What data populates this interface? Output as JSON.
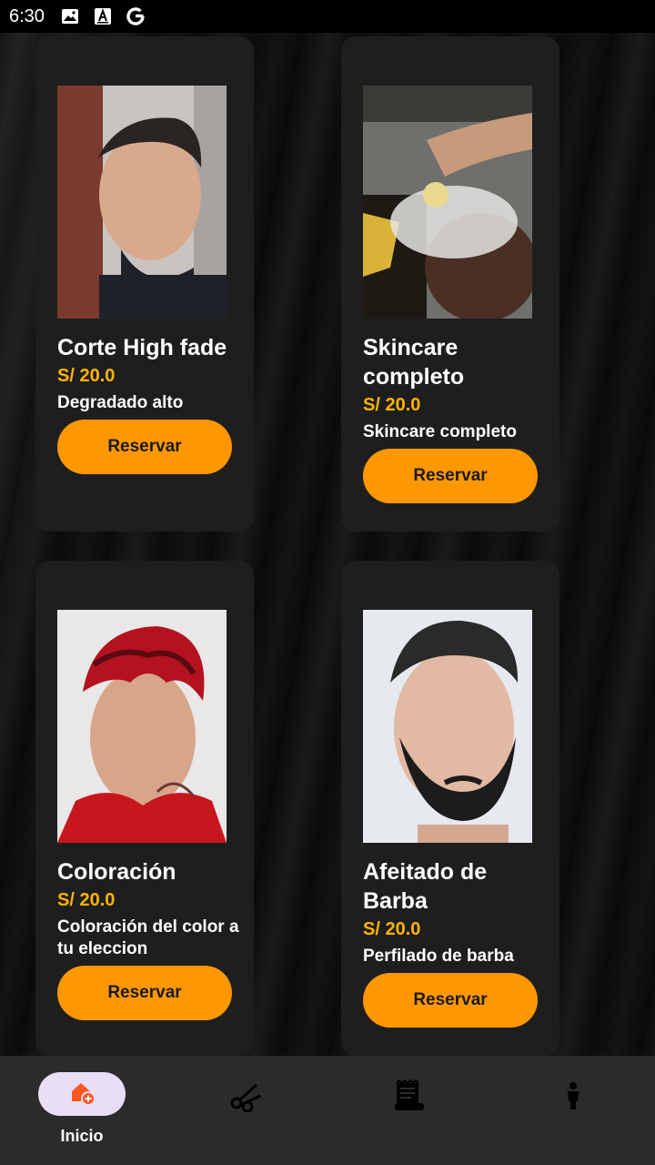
{
  "status_bar": {
    "time": "6:30",
    "icons": [
      "image-icon",
      "text-a-icon",
      "google-g-icon"
    ]
  },
  "services": [
    {
      "title": "Corte High fade",
      "price": "S/ 20.0",
      "description": "Degradado alto",
      "button_label": "Reservar",
      "image": "photo-high-fade-haircut"
    },
    {
      "title": "Skincare completo",
      "price": "S/ 20.0",
      "description": "Skincare completo",
      "button_label": "Reservar",
      "image": "photo-skincare-steam"
    },
    {
      "title": "Coloración",
      "price": "S/ 20.0",
      "description": "Coloración del color a tu eleccion",
      "button_label": "Reservar",
      "image": "photo-red-hair-coloring"
    },
    {
      "title": "Afeitado de Barba",
      "price": "S/ 20.0",
      "description": "Perfilado de barba",
      "button_label": "Reservar",
      "image": "photo-beard-shave"
    }
  ],
  "bottom_nav": {
    "items": [
      {
        "label": "Inicio",
        "icon": "home-add-icon",
        "active": true
      },
      {
        "label": "",
        "icon": "scissors-icon",
        "active": false
      },
      {
        "label": "",
        "icon": "receipt-icon",
        "active": false
      },
      {
        "label": "",
        "icon": "person-icon",
        "active": false
      }
    ]
  },
  "colors": {
    "accent": "#ff9800",
    "price": "#ffb300",
    "card_bg": "#1e1e1e",
    "nav_bg": "#2b2b2b",
    "active_pill": "#e8def8"
  }
}
